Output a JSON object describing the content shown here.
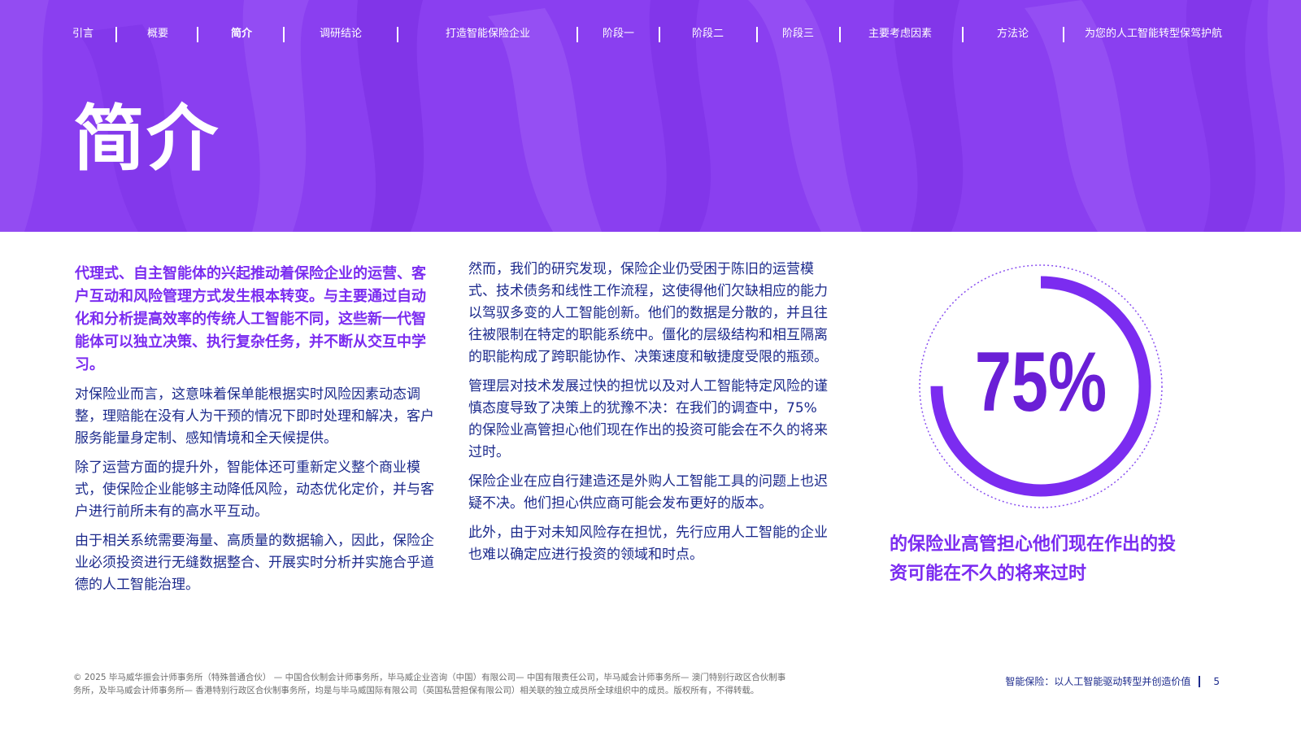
{
  "nav": {
    "items": [
      {
        "label": "引言"
      },
      {
        "label": "概要"
      },
      {
        "label": "简介"
      },
      {
        "label": "调研结论"
      },
      {
        "label": "打造智能保险企业"
      },
      {
        "label": "阶段一"
      },
      {
        "label": "阶段二"
      },
      {
        "label": "阶段三"
      },
      {
        "label": "主要考虑因素"
      },
      {
        "label": "方法论"
      },
      {
        "label": "为您的人工智能转型保驾护航"
      }
    ],
    "active_index": 2
  },
  "hero": {
    "title": "简介",
    "background_color": "#8a3ff0"
  },
  "column1": {
    "lead": "代理式、自主智能体的兴起推动着保险企业的运营、客户互动和风险管理方式发生根本转变。与主要通过自动化和分析提高效率的传统人工智能不同，这些新一代智能体可以独立决策、执行复杂任务，并不断从交互中学习。",
    "p1": "对保险业而言，这意味着保单能根据实时风险因素动态调整，理赔能在没有人为干预的情况下即时处理和解决，客户服务能量身定制、感知情境和全天候提供。",
    "p2": "除了运营方面的提升外，智能体还可重新定义整个商业模式，使保险企业能够主动降低风险，动态优化定价，并与客户进行前所未有的高水平互动。",
    "p3": "由于相关系统需要海量、高质量的数据输入，因此，保险企业必须投资进行无缝数据整合、开展实时分析并实施合乎道德的人工智能治理。"
  },
  "column2": {
    "p1": "然而，我们的研究发现，保险企业仍受困于陈旧的运营模式、技术债务和线性工作流程，这使得他们欠缺相应的能力以驾驭多变的人工智能创新。他们的数据是分散的，并且往往被限制在特定的职能系统中。僵化的层级结构和相互隔离的职能构成了跨职能协作、决策速度和敏捷度受限的瓶颈。",
    "p2": "管理层对技术发展过快的担忧以及对人工智能特定风险的谨慎态度导致了决策上的犹豫不决：在我们的调查中，75%的保险业高管担心他们现在作出的投资可能会在不久的将来过时。",
    "p3": "保险企业在应自行建造还是外购人工智能工具的问题上也迟疑不决。他们担心供应商可能会发布更好的版本。",
    "p4": "此外，由于对未知风险存在担忧，先行应用人工智能的企业也难以确定应进行投资的领域和时点。"
  },
  "stat": {
    "value_text": "75%",
    "percent": 75,
    "caption": "的保险业高管担心他们现在作出的投资可能在不久的将来过时",
    "accent_color": "#7b2cf0"
  },
  "footer": {
    "legal": "© 2025 毕马威华振会计师事务所（特殊普通合伙） — 中国合伙制会计师事务所，毕马威企业咨询（中国）有限公司— 中国有限责任公司，毕马威会计师事务所— 澳门特别行政区合伙制事务所，及毕马威会计师事务所— 香港特别行政区合伙制事务所，均是与毕马威国际有限公司（英国私营担保有限公司）相关联的独立成员所全球组织中的成员。版权所有，不得转载。",
    "doc_title": "智能保险：以人工智能驱动转型并创造价值",
    "page_number": "5"
  }
}
